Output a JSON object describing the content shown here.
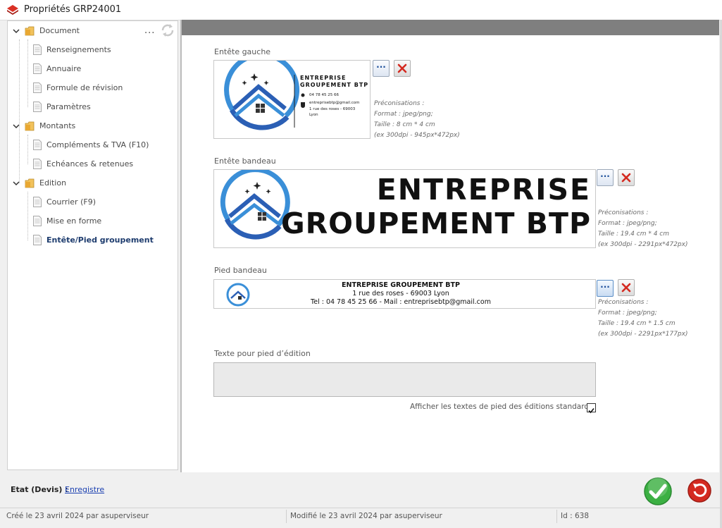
{
  "window": {
    "title": "Propriétés GRP24001"
  },
  "sidebar": {
    "more_label": "...",
    "groups": [
      {
        "label": "Document",
        "items": [
          "Renseignements",
          "Annuaire",
          "Formule de révision",
          "Paramètres"
        ]
      },
      {
        "label": "Montants",
        "items": [
          "Compléments & TVA (F10)",
          "Echéances & retenues"
        ]
      },
      {
        "label": "Edition",
        "items": [
          "Courrier (F9)",
          "Mise en forme",
          "Entête/Pied groupement"
        ]
      }
    ],
    "active_item": "Entête/Pied groupement"
  },
  "main": {
    "left_header": {
      "label": "Entête gauche",
      "image": {
        "company_line1": "ENTREPRISE",
        "company_line2": "GROUPEMENT BTP",
        "phone": "04 78 45 25 66",
        "email": "entreprisebtp@gmail.com",
        "address": "1 rue des roses - 69003",
        "city": "Lyon"
      },
      "browse_label": "...",
      "preco": [
        "Préconisations :",
        "Format : jpeg/png;",
        "Taille : 8 cm * 4 cm",
        "(ex 300dpi - 945px*472px)"
      ]
    },
    "banner_header": {
      "label": "Entête bandeau",
      "image": {
        "line1": "ENTREPRISE",
        "line2": "GROUPEMENT BTP"
      },
      "browse_label": "...",
      "preco": [
        "Préconisations :",
        "Format : jpeg/png;",
        "Taille : 19.4 cm * 4 cm",
        "(ex 300dpi - 2291px*472px)"
      ]
    },
    "banner_footer": {
      "label": "Pied bandeau",
      "image": {
        "line1": "ENTREPRISE GROUPEMENT BTP",
        "line2": "1 rue des roses - 69003 Lyon",
        "line3": "Tel : 04 78 45 25 66 - Mail : entreprisebtp@gmail.com"
      },
      "browse_label": "...",
      "preco": [
        "Préconisations :",
        "Format : jpeg/png;",
        "Taille : 19.4 cm * 1.5 cm",
        "(ex 300dpi - 2291px*177px)"
      ]
    },
    "footer_text": {
      "label": "Texte pour pied d’édition",
      "value": ""
    },
    "standard_footer": {
      "label": "Afficher les textes de pied des éditions standard",
      "checked": true
    }
  },
  "bottom": {
    "etat_label": "Etat (Devis) :",
    "etat_value": "Enregistre"
  },
  "statusbar": {
    "created": "Créé le 23 avril 2024 par asuperviseur",
    "modified": "Modifié le 23 avril 2024 par asuperviseur",
    "id": "Id : 638"
  },
  "colors": {
    "accent_blue": "#3a8fd8",
    "dark_blue": "#2b5fb5",
    "ok_green": "#3cb043",
    "cancel_red": "#d42a20"
  }
}
